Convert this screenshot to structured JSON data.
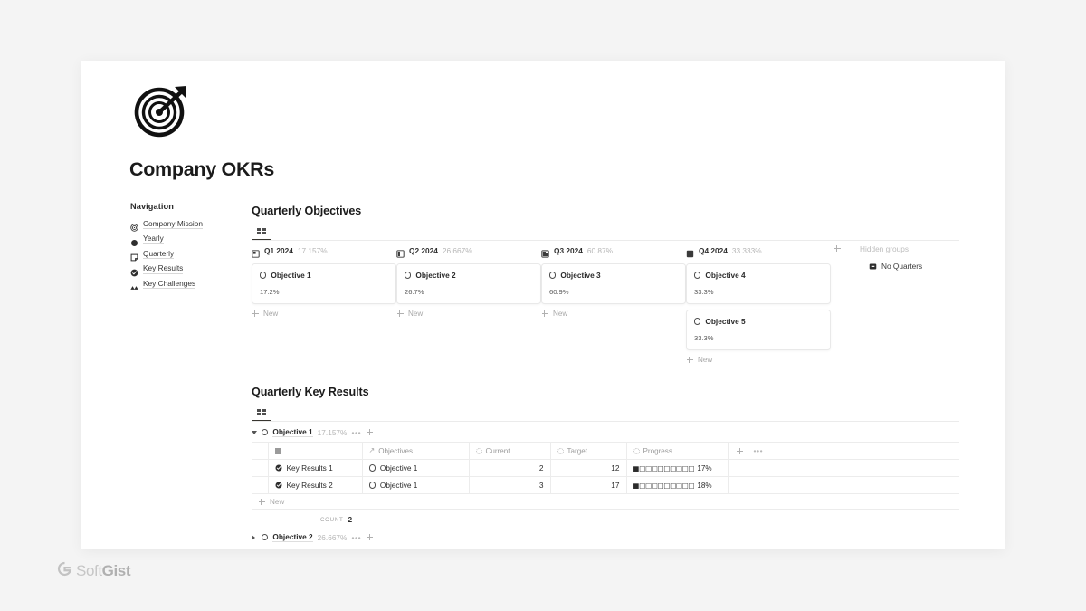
{
  "page": {
    "title": "Company OKRs",
    "cover_icon": "target-dartboard-icon"
  },
  "navigation": {
    "heading": "Navigation",
    "items": [
      {
        "label": "Company Mission",
        "icon": "target-icon"
      },
      {
        "label": "Yearly",
        "icon": "filled-circle-icon"
      },
      {
        "label": "Quarterly",
        "icon": "page-icon"
      },
      {
        "label": "Key Results",
        "icon": "check-circle-icon"
      },
      {
        "label": "Key Challenges",
        "icon": "mountains-icon"
      }
    ]
  },
  "objectives_section": {
    "title": "Quarterly Objectives",
    "view_icon": "board-grid-icon",
    "add_group_icon": "plus-icon",
    "hidden_groups_label": "Hidden groups",
    "hidden_group": {
      "label": "No Quarters",
      "icon": "archive-icon"
    },
    "new_label": "New",
    "columns": [
      {
        "name": "Q1 2024",
        "percent": "17.157%",
        "icon": "quarter-fill-1-icon",
        "cards": [
          {
            "title": "Objective 1",
            "percent": "17.2%",
            "icon": "circle-icon"
          }
        ]
      },
      {
        "name": "Q2 2024",
        "percent": "26.667%",
        "icon": "quarter-fill-2-icon",
        "cards": [
          {
            "title": "Objective 2",
            "percent": "26.7%",
            "icon": "circle-icon"
          }
        ]
      },
      {
        "name": "Q3 2024",
        "percent": "60.87%",
        "icon": "quarter-fill-3-icon",
        "cards": [
          {
            "title": "Objective 3",
            "percent": "60.9%",
            "icon": "circle-icon"
          }
        ]
      },
      {
        "name": "Q4 2024",
        "percent": "33.333%",
        "icon": "quarter-fill-4-icon",
        "cards": [
          {
            "title": "Objective 4",
            "percent": "33.3%",
            "icon": "circle-icon"
          },
          {
            "title": "Objective 5",
            "percent": "33.3%",
            "icon": "circle-icon"
          }
        ]
      }
    ]
  },
  "key_results_section": {
    "title": "Quarterly Key Results",
    "view_icon": "board-grid-icon",
    "new_label": "New",
    "count_label": "Count",
    "count_value": "2",
    "columns": [
      {
        "label": "",
        "icon": "square-icon"
      },
      {
        "label": "Objectives",
        "icon": "relation-arrow-icon"
      },
      {
        "label": "Current",
        "icon": "rollup-circle-icon"
      },
      {
        "label": "Target",
        "icon": "rollup-circle-icon"
      },
      {
        "label": "Progress",
        "icon": "rollup-circle-icon"
      }
    ],
    "groups": [
      {
        "name": "Objective 1",
        "percent": "17.157%",
        "icon": "circle-icon",
        "expanded": true,
        "rows": [
          {
            "name": "Key Results 1",
            "icon": "check-circle-icon",
            "objective": "Objective 1",
            "objective_icon": "circle-icon",
            "current": "2",
            "target": "12",
            "progress_filled": 1,
            "progress_total": 10,
            "progress_percent": "17%"
          },
          {
            "name": "Key Results 2",
            "icon": "check-circle-icon",
            "objective": "Objective 1",
            "objective_icon": "circle-icon",
            "current": "3",
            "target": "17",
            "progress_filled": 1,
            "progress_total": 10,
            "progress_percent": "18%"
          }
        ]
      },
      {
        "name": "Objective 2",
        "percent": "26.667%",
        "icon": "circle-icon",
        "expanded": false,
        "rows": []
      }
    ]
  },
  "watermark": {
    "brand_light": "Soft",
    "brand_bold": "Gist",
    "icon": "softgist-g-logo"
  },
  "colors": {
    "background": "#f4f4f4",
    "card": "#ffffff",
    "text": "#2b2b2b",
    "muted": "#b6b6b6",
    "border": "#ececec",
    "accent": "#37352f"
  }
}
